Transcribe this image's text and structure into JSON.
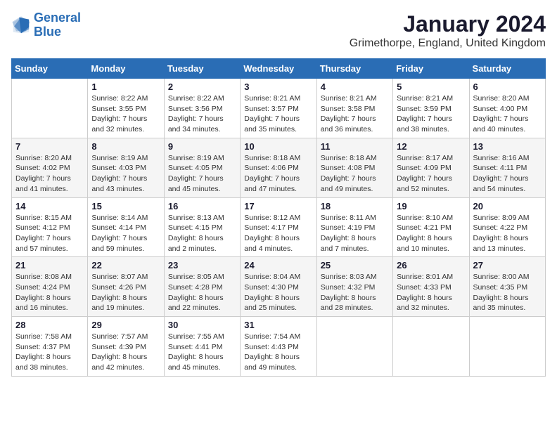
{
  "logo": {
    "line1": "General",
    "line2": "Blue"
  },
  "title": "January 2024",
  "subtitle": "Grimethorpe, England, United Kingdom",
  "days_of_week": [
    "Sunday",
    "Monday",
    "Tuesday",
    "Wednesday",
    "Thursday",
    "Friday",
    "Saturday"
  ],
  "weeks": [
    [
      {
        "day": "",
        "sunrise": "",
        "sunset": "",
        "daylight": ""
      },
      {
        "day": "1",
        "sunrise": "Sunrise: 8:22 AM",
        "sunset": "Sunset: 3:55 PM",
        "daylight": "Daylight: 7 hours and 32 minutes."
      },
      {
        "day": "2",
        "sunrise": "Sunrise: 8:22 AM",
        "sunset": "Sunset: 3:56 PM",
        "daylight": "Daylight: 7 hours and 34 minutes."
      },
      {
        "day": "3",
        "sunrise": "Sunrise: 8:21 AM",
        "sunset": "Sunset: 3:57 PM",
        "daylight": "Daylight: 7 hours and 35 minutes."
      },
      {
        "day": "4",
        "sunrise": "Sunrise: 8:21 AM",
        "sunset": "Sunset: 3:58 PM",
        "daylight": "Daylight: 7 hours and 36 minutes."
      },
      {
        "day": "5",
        "sunrise": "Sunrise: 8:21 AM",
        "sunset": "Sunset: 3:59 PM",
        "daylight": "Daylight: 7 hours and 38 minutes."
      },
      {
        "day": "6",
        "sunrise": "Sunrise: 8:20 AM",
        "sunset": "Sunset: 4:00 PM",
        "daylight": "Daylight: 7 hours and 40 minutes."
      }
    ],
    [
      {
        "day": "7",
        "sunrise": "Sunrise: 8:20 AM",
        "sunset": "Sunset: 4:02 PM",
        "daylight": "Daylight: 7 hours and 41 minutes."
      },
      {
        "day": "8",
        "sunrise": "Sunrise: 8:19 AM",
        "sunset": "Sunset: 4:03 PM",
        "daylight": "Daylight: 7 hours and 43 minutes."
      },
      {
        "day": "9",
        "sunrise": "Sunrise: 8:19 AM",
        "sunset": "Sunset: 4:05 PM",
        "daylight": "Daylight: 7 hours and 45 minutes."
      },
      {
        "day": "10",
        "sunrise": "Sunrise: 8:18 AM",
        "sunset": "Sunset: 4:06 PM",
        "daylight": "Daylight: 7 hours and 47 minutes."
      },
      {
        "day": "11",
        "sunrise": "Sunrise: 8:18 AM",
        "sunset": "Sunset: 4:08 PM",
        "daylight": "Daylight: 7 hours and 49 minutes."
      },
      {
        "day": "12",
        "sunrise": "Sunrise: 8:17 AM",
        "sunset": "Sunset: 4:09 PM",
        "daylight": "Daylight: 7 hours and 52 minutes."
      },
      {
        "day": "13",
        "sunrise": "Sunrise: 8:16 AM",
        "sunset": "Sunset: 4:11 PM",
        "daylight": "Daylight: 7 hours and 54 minutes."
      }
    ],
    [
      {
        "day": "14",
        "sunrise": "Sunrise: 8:15 AM",
        "sunset": "Sunset: 4:12 PM",
        "daylight": "Daylight: 7 hours and 57 minutes."
      },
      {
        "day": "15",
        "sunrise": "Sunrise: 8:14 AM",
        "sunset": "Sunset: 4:14 PM",
        "daylight": "Daylight: 7 hours and 59 minutes."
      },
      {
        "day": "16",
        "sunrise": "Sunrise: 8:13 AM",
        "sunset": "Sunset: 4:15 PM",
        "daylight": "Daylight: 8 hours and 2 minutes."
      },
      {
        "day": "17",
        "sunrise": "Sunrise: 8:12 AM",
        "sunset": "Sunset: 4:17 PM",
        "daylight": "Daylight: 8 hours and 4 minutes."
      },
      {
        "day": "18",
        "sunrise": "Sunrise: 8:11 AM",
        "sunset": "Sunset: 4:19 PM",
        "daylight": "Daylight: 8 hours and 7 minutes."
      },
      {
        "day": "19",
        "sunrise": "Sunrise: 8:10 AM",
        "sunset": "Sunset: 4:21 PM",
        "daylight": "Daylight: 8 hours and 10 minutes."
      },
      {
        "day": "20",
        "sunrise": "Sunrise: 8:09 AM",
        "sunset": "Sunset: 4:22 PM",
        "daylight": "Daylight: 8 hours and 13 minutes."
      }
    ],
    [
      {
        "day": "21",
        "sunrise": "Sunrise: 8:08 AM",
        "sunset": "Sunset: 4:24 PM",
        "daylight": "Daylight: 8 hours and 16 minutes."
      },
      {
        "day": "22",
        "sunrise": "Sunrise: 8:07 AM",
        "sunset": "Sunset: 4:26 PM",
        "daylight": "Daylight: 8 hours and 19 minutes."
      },
      {
        "day": "23",
        "sunrise": "Sunrise: 8:05 AM",
        "sunset": "Sunset: 4:28 PM",
        "daylight": "Daylight: 8 hours and 22 minutes."
      },
      {
        "day": "24",
        "sunrise": "Sunrise: 8:04 AM",
        "sunset": "Sunset: 4:30 PM",
        "daylight": "Daylight: 8 hours and 25 minutes."
      },
      {
        "day": "25",
        "sunrise": "Sunrise: 8:03 AM",
        "sunset": "Sunset: 4:32 PM",
        "daylight": "Daylight: 8 hours and 28 minutes."
      },
      {
        "day": "26",
        "sunrise": "Sunrise: 8:01 AM",
        "sunset": "Sunset: 4:33 PM",
        "daylight": "Daylight: 8 hours and 32 minutes."
      },
      {
        "day": "27",
        "sunrise": "Sunrise: 8:00 AM",
        "sunset": "Sunset: 4:35 PM",
        "daylight": "Daylight: 8 hours and 35 minutes."
      }
    ],
    [
      {
        "day": "28",
        "sunrise": "Sunrise: 7:58 AM",
        "sunset": "Sunset: 4:37 PM",
        "daylight": "Daylight: 8 hours and 38 minutes."
      },
      {
        "day": "29",
        "sunrise": "Sunrise: 7:57 AM",
        "sunset": "Sunset: 4:39 PM",
        "daylight": "Daylight: 8 hours and 42 minutes."
      },
      {
        "day": "30",
        "sunrise": "Sunrise: 7:55 AM",
        "sunset": "Sunset: 4:41 PM",
        "daylight": "Daylight: 8 hours and 45 minutes."
      },
      {
        "day": "31",
        "sunrise": "Sunrise: 7:54 AM",
        "sunset": "Sunset: 4:43 PM",
        "daylight": "Daylight: 8 hours and 49 minutes."
      },
      {
        "day": "",
        "sunrise": "",
        "sunset": "",
        "daylight": ""
      },
      {
        "day": "",
        "sunrise": "",
        "sunset": "",
        "daylight": ""
      },
      {
        "day": "",
        "sunrise": "",
        "sunset": "",
        "daylight": ""
      }
    ]
  ]
}
